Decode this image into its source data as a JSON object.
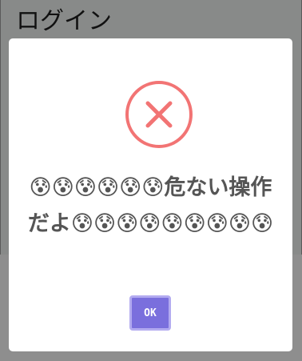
{
  "page": {
    "title": "ログイン"
  },
  "dialog": {
    "icon": "error-x-circle-icon",
    "icon_color": "#f27474",
    "message": "😰😰😰😰😰😰危ない操作だよ😰😰😰😰😰😰😰😰😰",
    "confirm_label": "OK",
    "confirm_color": "#7a6fdd"
  },
  "colors": {
    "backdrop": "#888a89",
    "dialog_background": "#ffffff",
    "message_text": "#555555"
  }
}
